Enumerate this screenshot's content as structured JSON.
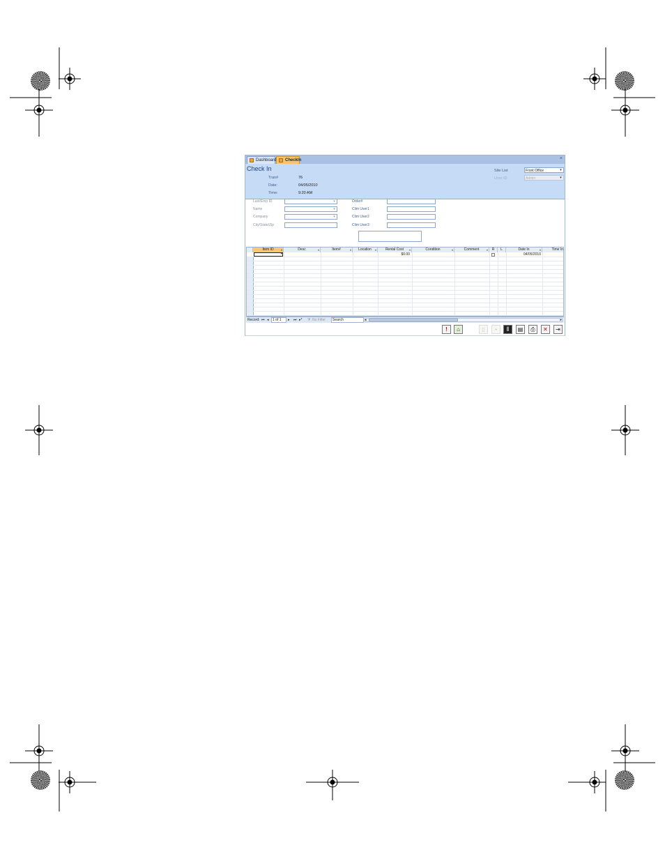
{
  "tabs": [
    {
      "label": "Dashboard",
      "active": false
    },
    {
      "label": "CheckIn",
      "active": true
    }
  ],
  "tab_close": "×",
  "form": {
    "title": "Check In",
    "fields": [
      {
        "label": "Tran#",
        "value": "76"
      },
      {
        "label": "Date:",
        "value": "04/05/2010"
      },
      {
        "label": "Time:",
        "value": "9:20 AM"
      }
    ],
    "site_list_label": "Site List",
    "site_list_value": "Front Office",
    "user_id_label": "User ID",
    "user_id_value": "Admin"
  },
  "left_fields": [
    "Last/Emp ID",
    "Name",
    "Company",
    "City/State/Zip"
  ],
  "right_fields": [
    "Order#",
    "Clim User1",
    "Clim User2",
    "Clim User3"
  ],
  "grid": {
    "columns": [
      "Item ID",
      "Desc",
      "Item#",
      "Location",
      "Rental Cost",
      "Condition",
      "Comment",
      "R",
      "L",
      "Date In",
      "Time In"
    ],
    "row": {
      "rental_cost": "$0.00",
      "date_in": "04/05/2010"
    }
  },
  "navigator": {
    "record_label": "Record:",
    "position": "1 of 1",
    "filter_label": "No Filter",
    "search_label": "Search"
  },
  "colors": {
    "accent": "#f6c66b",
    "header_bg": "#c6dbf5",
    "tabbar_bg": "#a9c1e2"
  }
}
